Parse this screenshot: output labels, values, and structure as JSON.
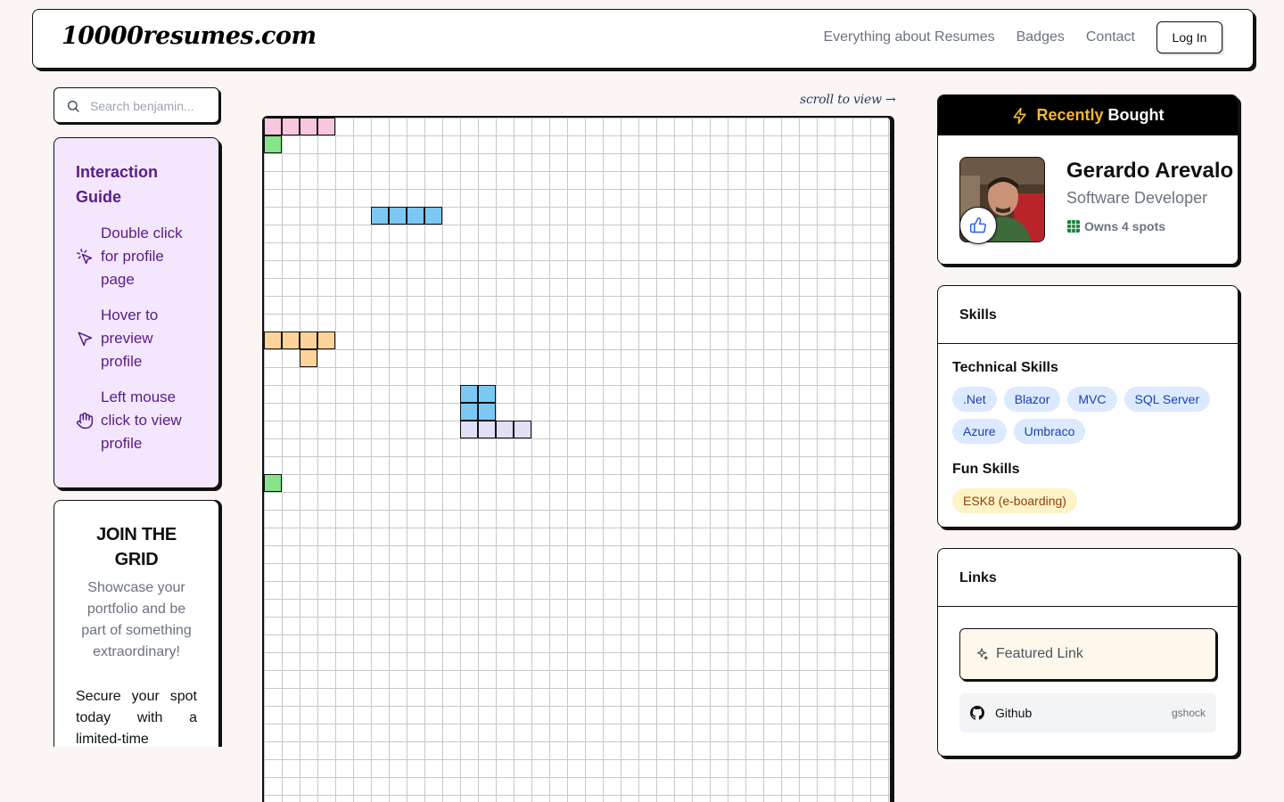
{
  "header": {
    "logo": "10000resumes.com",
    "nav": [
      "Everything about Resumes",
      "Badges",
      "Contact"
    ],
    "login_label": "Log In"
  },
  "search": {
    "placeholder": "Search benjamin..."
  },
  "guide": {
    "title": "Interaction Guide",
    "items": [
      {
        "icon": "pointer-click-icon",
        "label": "Double click for profile page"
      },
      {
        "icon": "cursor-arrow-icon",
        "label": "Hover to preview profile"
      },
      {
        "icon": "hand-pointer-icon",
        "label": "Left mouse click to view profile"
      }
    ]
  },
  "join": {
    "title": "JOIN THE GRID",
    "subtitle": "Showcase your portfolio and be part of something extraordinary!",
    "body": "Secure your spot today with a limited-time special"
  },
  "grid": {
    "scroll_hint": "scroll to view →",
    "cells": [
      {
        "col": 0,
        "row": 0,
        "color": "#f9c6e0"
      },
      {
        "col": 1,
        "row": 0,
        "color": "#f9c6e0"
      },
      {
        "col": 2,
        "row": 0,
        "color": "#f9c6e0"
      },
      {
        "col": 3,
        "row": 0,
        "color": "#f9c6e0"
      },
      {
        "col": 0,
        "row": 1,
        "color": "#86e58a"
      },
      {
        "col": 6,
        "row": 5,
        "color": "#7cc8f5"
      },
      {
        "col": 7,
        "row": 5,
        "color": "#7cc8f5"
      },
      {
        "col": 8,
        "row": 5,
        "color": "#7cc8f5"
      },
      {
        "col": 9,
        "row": 5,
        "color": "#7cc8f5"
      },
      {
        "col": 0,
        "row": 12,
        "color": "#fcd49a"
      },
      {
        "col": 1,
        "row": 12,
        "color": "#fcd49a"
      },
      {
        "col": 2,
        "row": 12,
        "color": "#fcd49a"
      },
      {
        "col": 3,
        "row": 12,
        "color": "#fcd49a"
      },
      {
        "col": 2,
        "row": 13,
        "color": "#fcd49a"
      },
      {
        "col": 11,
        "row": 15,
        "color": "#7cc8f5"
      },
      {
        "col": 12,
        "row": 15,
        "color": "#7cc8f5"
      },
      {
        "col": 11,
        "row": 16,
        "color": "#7cc8f5"
      },
      {
        "col": 12,
        "row": 16,
        "color": "#7cc8f5"
      },
      {
        "col": 11,
        "row": 17,
        "color": "#e2e0f7"
      },
      {
        "col": 12,
        "row": 17,
        "color": "#e2e0f7"
      },
      {
        "col": 13,
        "row": 17,
        "color": "#e2e0f7"
      },
      {
        "col": 14,
        "row": 17,
        "color": "#e2e0f7"
      },
      {
        "col": 0,
        "row": 20,
        "color": "#86e58a"
      }
    ]
  },
  "recent": {
    "title_highlight": "Recently",
    "title_rest": "Bought",
    "name": "Gerardo Arevalo",
    "role": "Software Developer",
    "spots": "Owns 4 spots"
  },
  "skills": {
    "title": "Skills",
    "technical_title": "Technical Skills",
    "technical": [
      ".Net",
      "Blazor",
      "MVC",
      "SQL Server",
      "Azure",
      "Umbraco"
    ],
    "fun_title": "Fun Skills",
    "fun": [
      "ESK8 (e-boarding)"
    ]
  },
  "links": {
    "title": "Links",
    "featured": "Featured Link",
    "github_label": "Github",
    "github_user": "gshock"
  }
}
